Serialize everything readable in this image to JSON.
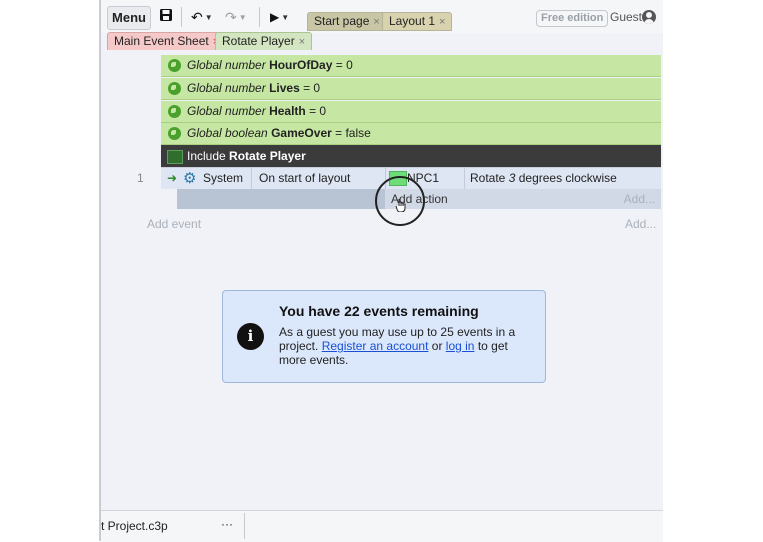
{
  "toolbar": {
    "menu_label": "Menu",
    "tabs": [
      {
        "label": "Start page",
        "close": "×"
      },
      {
        "label": "Layout 1",
        "close": "×"
      }
    ],
    "free_edition": "Free edition",
    "guest_label": "Guest"
  },
  "subtabs": [
    {
      "label": "Main Event Sheet",
      "close": "×"
    },
    {
      "label": "Rotate Player",
      "close": "×"
    }
  ],
  "globals": [
    {
      "prefix": "Global number",
      "name": "HourOfDay",
      "suffix": "= 0"
    },
    {
      "prefix": "Global number",
      "name": "Lives",
      "suffix": "= 0"
    },
    {
      "prefix": "Global number",
      "name": "Health",
      "suffix": "= 0"
    },
    {
      "prefix": "Global boolean",
      "name": "GameOver",
      "suffix": "= false"
    }
  ],
  "include": {
    "prefix": "Include",
    "name": "Rotate Player"
  },
  "event": {
    "number": "1",
    "object": "System",
    "condition": "On start of layout",
    "action_object": "NPC1",
    "action_text_before": "Rotate",
    "action_value": "3",
    "action_text_after": "degrees clockwise",
    "add_action": "Add action",
    "add_small": "Add..."
  },
  "add_event": "Add event",
  "add_event_right": "Add...",
  "notice": {
    "title": "You have 22 events remaining",
    "line_before": "As a guest you may use up to 25 events in a project.",
    "register_link": "Register an account",
    "or_text": "or",
    "login_link": "log in",
    "after_text": "to get more events."
  },
  "bottom": {
    "project_name": "t Project.c3p",
    "more": "···"
  },
  "colors": {
    "global_var_bg": "#c6e7a3",
    "include_bg": "#3b3b3b",
    "notice_bg": "#dbe8fb",
    "link": "#1a4fd6",
    "tab_start": "#c9c6a6",
    "tab_layout": "#d8d3ae",
    "subtab_active": "#f6c9c9",
    "subtab_other": "#d3e6c1"
  }
}
